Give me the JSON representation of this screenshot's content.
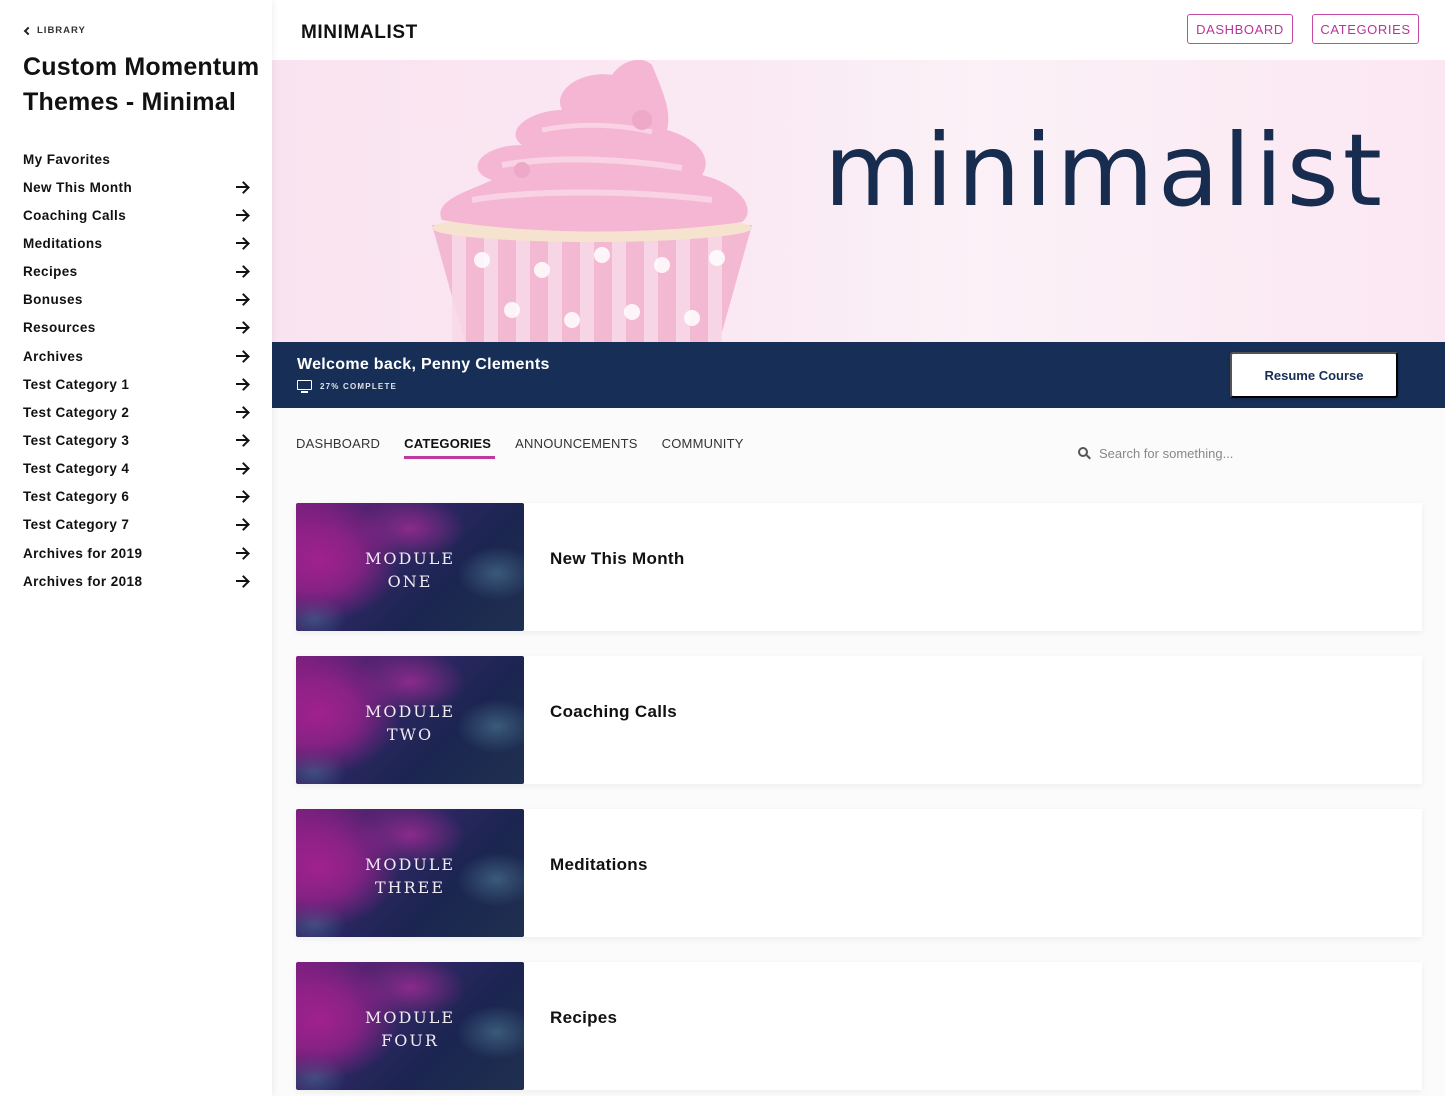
{
  "sidebar": {
    "back_label": "LIBRARY",
    "course_title": "Custom Momentum Themes - Minimal",
    "items": [
      {
        "label": "My Favorites",
        "has_arrow": false
      },
      {
        "label": "New This Month",
        "has_arrow": true
      },
      {
        "label": "Coaching Calls",
        "has_arrow": true
      },
      {
        "label": "Meditations",
        "has_arrow": true
      },
      {
        "label": "Recipes",
        "has_arrow": true
      },
      {
        "label": "Bonuses",
        "has_arrow": true
      },
      {
        "label": "Resources",
        "has_arrow": true
      },
      {
        "label": "Archives",
        "has_arrow": true
      },
      {
        "label": "Test Category 1",
        "has_arrow": true
      },
      {
        "label": "Test Category 2",
        "has_arrow": true
      },
      {
        "label": "Test Category 3",
        "has_arrow": true
      },
      {
        "label": "Test Category 4",
        "has_arrow": true
      },
      {
        "label": "Test Category 6",
        "has_arrow": true
      },
      {
        "label": "Test Category 7",
        "has_arrow": true
      },
      {
        "label": "Archives for 2019",
        "has_arrow": true
      },
      {
        "label": "Archives for 2018",
        "has_arrow": true
      }
    ]
  },
  "header": {
    "brand": "MINIMALIST",
    "buttons": {
      "dashboard": "DASHBOARD",
      "categories": "CATEGORIES"
    }
  },
  "hero": {
    "text": "minimalist"
  },
  "welcome": {
    "title": "Welcome back, Penny Clements",
    "progress_percent": 27,
    "progress_label": "27% COMPLETE",
    "resume_label": "Resume Course"
  },
  "tabs": [
    {
      "label": "DASHBOARD",
      "active": false
    },
    {
      "label": "CATEGORIES",
      "active": true
    },
    {
      "label": "ANNOUNCEMENTS",
      "active": false
    },
    {
      "label": "COMMUNITY",
      "active": false
    }
  ],
  "search": {
    "placeholder": "Search for something...",
    "value": ""
  },
  "modules": [
    {
      "thumb_line1": "MODULE",
      "thumb_line2": "ONE",
      "title": "New This Month"
    },
    {
      "thumb_line1": "MODULE",
      "thumb_line2": "TWO",
      "title": "Coaching Calls"
    },
    {
      "thumb_line1": "MODULE",
      "thumb_line2": "THREE",
      "title": "Meditations"
    },
    {
      "thumb_line1": "MODULE",
      "thumb_line2": "FOUR",
      "title": "Recipes"
    }
  ],
  "colors": {
    "accent": "#c0399f",
    "navy": "#172f57",
    "hero_text": "#172c4e"
  }
}
